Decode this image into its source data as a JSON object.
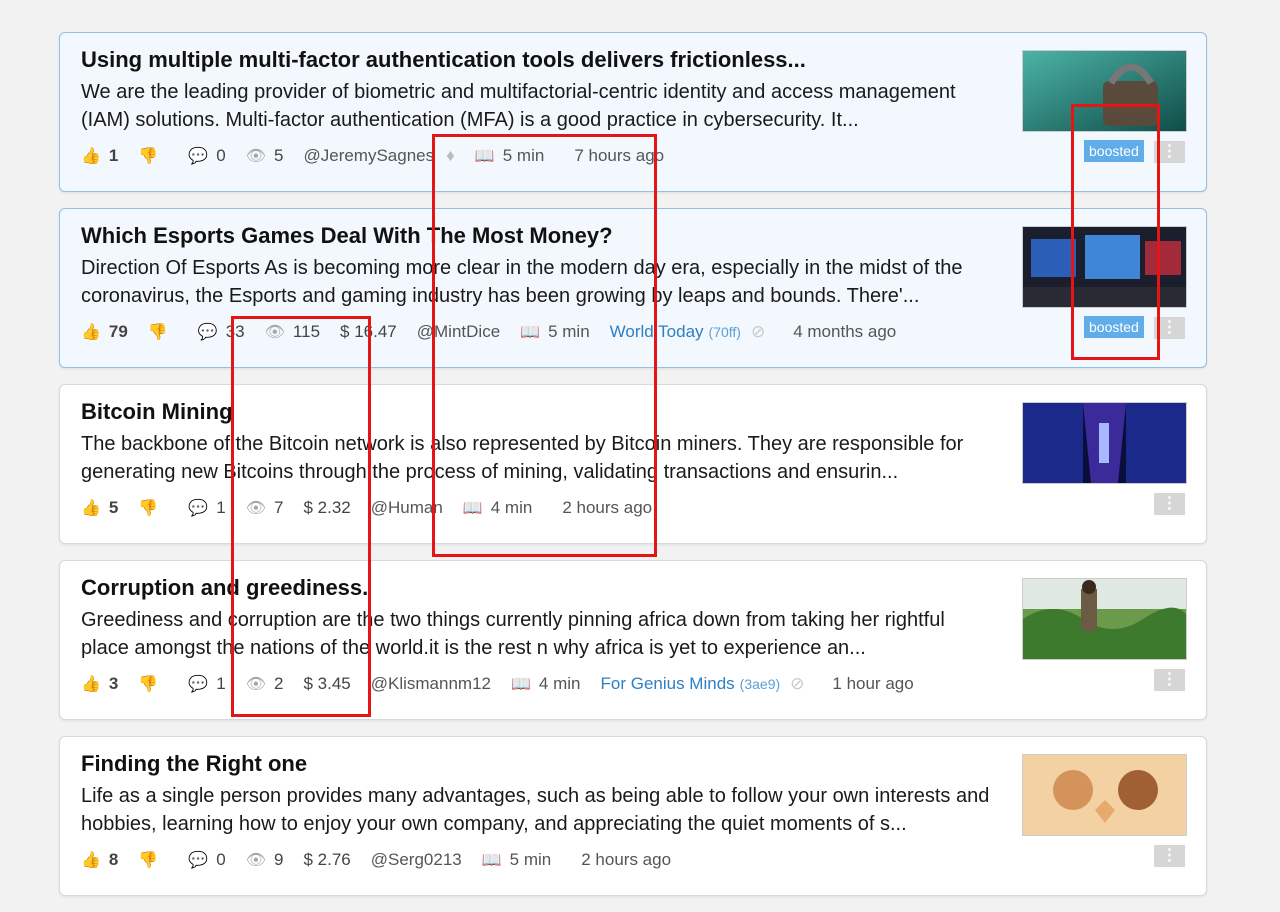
{
  "posts": [
    {
      "title": "Using multiple multi-factor authentication tools delivers frictionless...",
      "excerpt": "We are the leading provider of biometric and multifactorial-centric identity and access management (IAM) solutions. Multi-factor authentication (MFA) is a good practice in cybersecurity. It...",
      "upvotes": "1",
      "comments": "0",
      "views": "5",
      "author": "@JeremySagnes",
      "read_time": "5 min",
      "time_ago": "7 hours ago",
      "badge": "boosted",
      "menu": "⋮",
      "thumb_icon": "padlock-image"
    },
    {
      "title": "Which Esports Games Deal With The Most Money?",
      "excerpt": "Direction Of Esports As is becoming more clear in the modern day era, especially in the midst of the coronavirus, the Esports and gaming industry has been growing by leaps and bounds. There'...",
      "upvotes": "79",
      "comments": "33",
      "views": "115",
      "earnings": "$ 16.47",
      "author": "@MintDice",
      "read_time": "5 min",
      "community": "World Today",
      "community_code": "(70ff)",
      "time_ago": "4 months ago",
      "badge": "boosted",
      "menu": "⋮",
      "thumb_icon": "gaming-setup-image"
    },
    {
      "title": "Bitcoin Mining",
      "excerpt": "The backbone of the Bitcoin network is also represented by Bitcoin miners. They are responsible for generating new Bitcoins through the process of mining, validating transactions and ensurin...",
      "upvotes": "5",
      "comments": "1",
      "views": "7",
      "earnings": "$ 2.32",
      "author": "@Human",
      "read_time": "4 min",
      "time_ago": "2 hours ago",
      "menu": "⋮",
      "thumb_icon": "server-room-image"
    },
    {
      "title": "Corruption and greediness.",
      "excerpt": "Greediness and corruption are the two things currently pinning africa down from taking her rightful place amongst the nations of the world.it is the rest n why africa is yet to experience an...",
      "upvotes": "3",
      "comments": "1",
      "views": "2",
      "earnings": "$ 3.45",
      "author": "@Klismannm12",
      "read_time": "4 min",
      "community": "For Genius Minds",
      "community_code": "(3ae9)",
      "time_ago": "1 hour ago",
      "menu": "⋮",
      "thumb_icon": "farmer-field-image"
    },
    {
      "title": "Finding the Right one",
      "excerpt": "Life as a single person provides many advantages, such as being able to follow your own interests and hobbies, learning how to enjoy your own company, and appreciating the quiet moments of s...",
      "upvotes": "8",
      "comments": "0",
      "views": "9",
      "earnings": "$ 2.76",
      "author": "@Serg0213",
      "read_time": "5 min",
      "time_ago": "2 hours ago",
      "menu": "⋮",
      "thumb_icon": "couple-heart-image"
    }
  ],
  "colors": {
    "boosted_bg": "#f2f8fd",
    "boosted_border": "#8fc2e6",
    "badge": "#5fadea",
    "community_link": "#2f7fc1",
    "annotation": "#e31515"
  }
}
